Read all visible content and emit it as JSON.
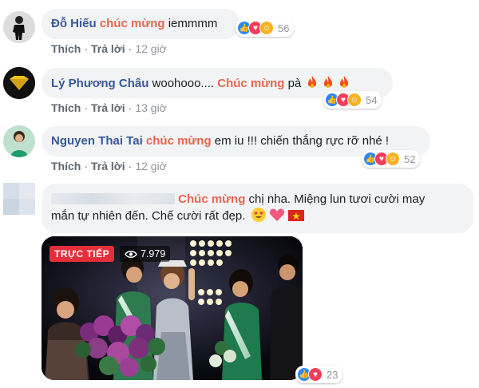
{
  "comments": [
    {
      "author": "Đỗ Hiếu",
      "highlight": "chúc mừng",
      "text_after": " iemmmm",
      "actions": {
        "like": "Thích",
        "reply": "Trả lời",
        "time": "12 giờ"
      },
      "reactions": {
        "icons": [
          "like-icon",
          "love-icon",
          "haha-icon"
        ],
        "count": "56"
      }
    },
    {
      "author": "Lý Phương Châu",
      "text_before": " woohooo.... ",
      "highlight": "Chúc mừng",
      "text_after": " pà",
      "emoji": [
        "fire-icon",
        "fire-icon",
        "fire-icon"
      ],
      "actions": {
        "like": "Thích",
        "reply": "Trả lời",
        "time": "13 giờ"
      },
      "reactions": {
        "icons": [
          "like-icon",
          "love-icon",
          "haha-icon"
        ],
        "count": "54"
      }
    },
    {
      "author": "Nguyen Thai Tai",
      "highlight": "chúc mừng",
      "text_after": " em iu !!! chiến thắng rực rỡ nhé !",
      "actions": {
        "like": "Thích",
        "reply": "Trả lời",
        "time": "12 giờ"
      },
      "reactions": {
        "icons": [
          "like-icon",
          "love-icon",
          "haha-icon"
        ],
        "count": "52"
      }
    },
    {
      "author": "",
      "highlight": "Chúc mừng",
      "text_after": " chị nha. Miệng lun tươi cười may",
      "line2": "mắn tự nhiên đến. Chế cười rất đẹp.",
      "emoji": [
        "heart-eyes-icon",
        "heart-icon",
        "vietnam-flag-icon"
      ],
      "photo": {
        "badge": "TRỰC TIẾP",
        "views": "7.979"
      },
      "reactions": {
        "icons": [
          "like-icon",
          "love-icon"
        ],
        "count": "23"
      }
    }
  ]
}
